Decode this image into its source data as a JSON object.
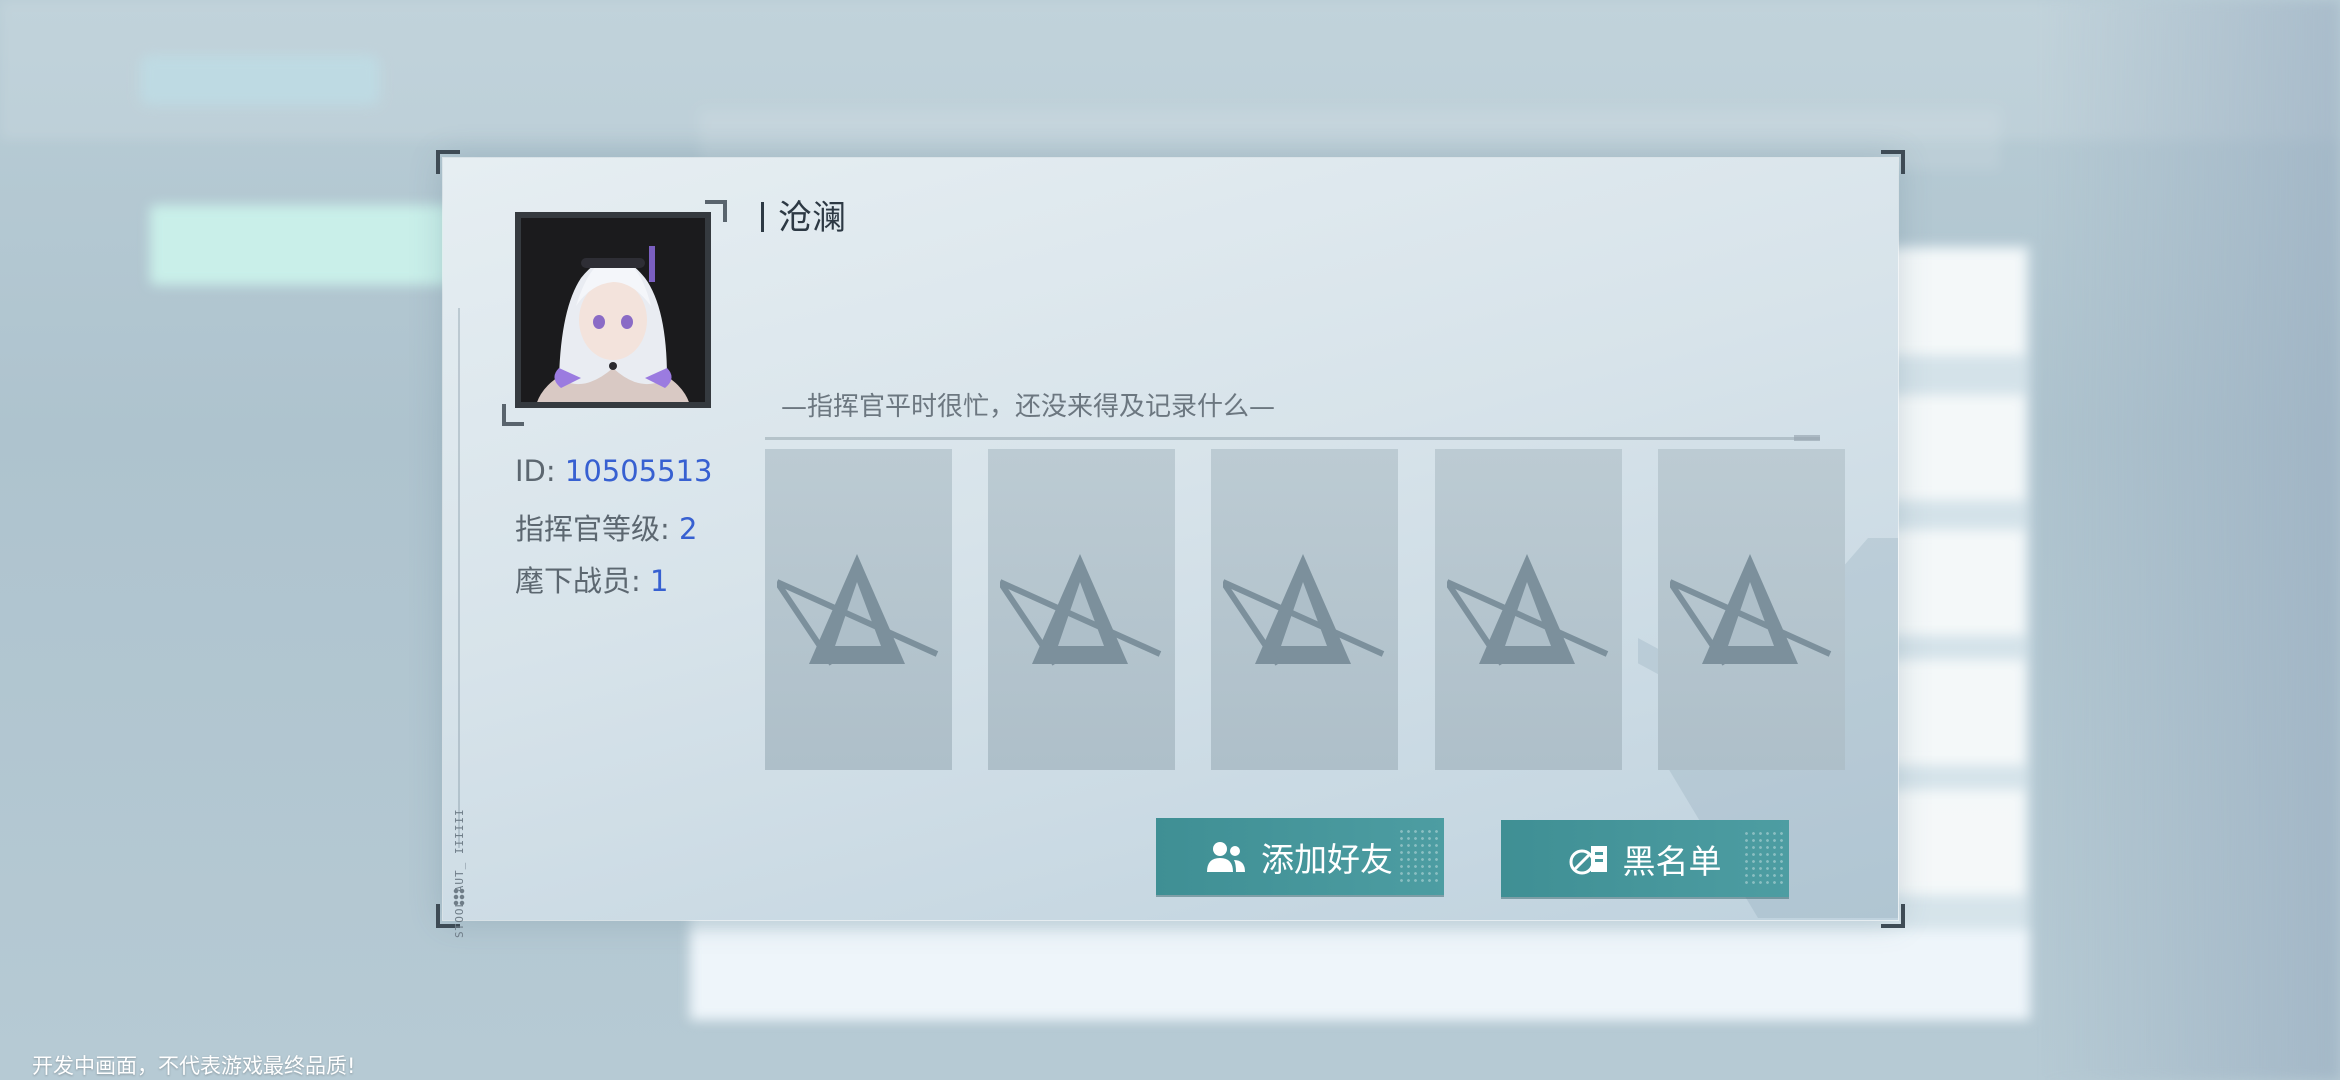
{
  "profile": {
    "name": "沧澜",
    "id_label": "ID:",
    "id_value": "10505513",
    "level_label": "指挥官等级:",
    "level_value": "2",
    "members_label": "麾下战员:",
    "members_value": "1",
    "motto": "—指挥官平时很忙，还没来得及记录什么—",
    "vertical_tag": "STOOL AUT_ IIIIII"
  },
  "slots": [
    {
      "icon": "emblem-placeholder-icon"
    },
    {
      "icon": "emblem-placeholder-icon"
    },
    {
      "icon": "emblem-placeholder-icon"
    },
    {
      "icon": "emblem-placeholder-icon"
    },
    {
      "icon": "emblem-placeholder-icon"
    }
  ],
  "actions": {
    "add_friend_label": "添加好友",
    "blacklist_label": "黑名单"
  },
  "footer": {
    "notice": "开发中画面，不代表游戏最终品质!"
  },
  "colors": {
    "accent_button": "#4a999e",
    "value_text": "#3760d1",
    "name_text": "#2d3944"
  }
}
